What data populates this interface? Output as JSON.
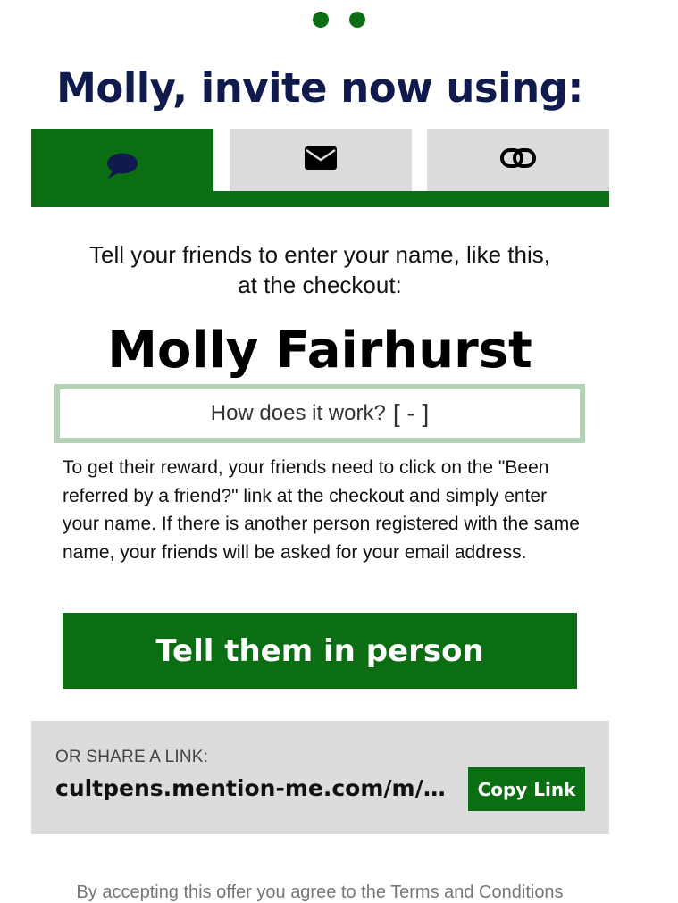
{
  "header": {
    "headline": "Molly, invite now using:"
  },
  "tabs": [
    {
      "icon": "chat-bubble-icon",
      "active": true
    },
    {
      "icon": "envelope-icon",
      "active": false
    },
    {
      "icon": "link-icon",
      "active": false
    }
  ],
  "main": {
    "instructions": "Tell your friends to enter your name, like this, at the checkout:",
    "name": "Molly Fairhurst",
    "how_it_works_label": "How does it work?",
    "how_it_works_toggle": "[ - ]",
    "explanation": "To get their reward, your friends need to click on the \"Been referred by a friend?\" link at the checkout and simply enter your name. If there is another person registered with the same name, your friends will be asked for your email address.",
    "cta_label": "Tell them in person"
  },
  "share": {
    "label": "OR SHARE A LINK:",
    "url": "cultpens.mention-me.com/m/ol/...",
    "copy_label": "Copy Link"
  },
  "footer": {
    "terms": "By accepting this offer you agree to the Terms and Conditions"
  },
  "colors": {
    "brand_green": "#0b6e12",
    "headline_navy": "#0f1a4d",
    "tab_gray": "#dcdcdc",
    "box_border": "#b5d1b5"
  }
}
